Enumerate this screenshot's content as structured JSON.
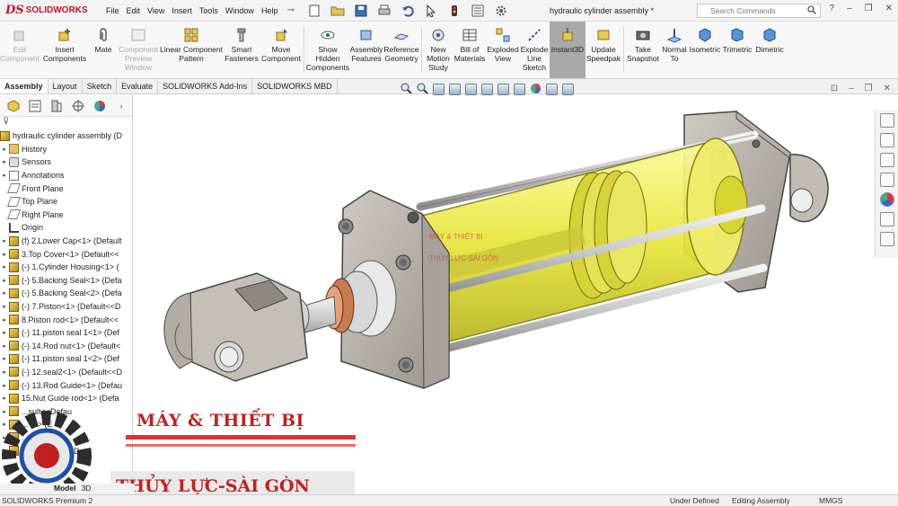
{
  "app": {
    "logo_ds": "DS",
    "logo_text": "SOLIDWORKS",
    "document_title": "hydraulic cylinder assembly *"
  },
  "menu": [
    "File",
    "Edit",
    "View",
    "Insert",
    "Tools",
    "Window",
    "Help"
  ],
  "search": {
    "placeholder": "Search Commands"
  },
  "command_manager": [
    {
      "label": "Edit Component",
      "disabled": true
    },
    {
      "label": "Insert Components",
      "disabled": false
    },
    {
      "label": "Mate",
      "disabled": false
    },
    {
      "label": "Component Preview Window",
      "disabled": true
    },
    {
      "label": "Linear Component Pattern",
      "disabled": false
    },
    {
      "label": "Smart Fasteners",
      "disabled": false
    },
    {
      "label": "Move Component",
      "disabled": false
    },
    {
      "label": "Show Hidden Components",
      "disabled": false
    },
    {
      "label": "Assembly Features",
      "disabled": false
    },
    {
      "label": "Reference Geometry",
      "disabled": false
    },
    {
      "label": "New Motion Study",
      "disabled": false
    },
    {
      "label": "Bill of Materials",
      "disabled": false
    },
    {
      "label": "Exploded View",
      "disabled": false
    },
    {
      "label": "Explode Line Sketch",
      "disabled": false
    },
    {
      "label": "Instant3D",
      "disabled": false,
      "active": true
    },
    {
      "label": "Update Speedpak",
      "disabled": false
    },
    {
      "label": "Take Snapshot",
      "disabled": false
    },
    {
      "label": "Normal To",
      "disabled": false
    },
    {
      "label": "Isometric",
      "disabled": false
    },
    {
      "label": "Trimetric",
      "disabled": false
    },
    {
      "label": "Dimetric",
      "disabled": false
    }
  ],
  "tabs": [
    "Assembly",
    "Layout",
    "Sketch",
    "Evaluate",
    "SOLIDWORKS Add-Ins",
    "SOLIDWORKS MBD"
  ],
  "tree": {
    "root": "hydraulic cylinder assembly  (D",
    "items": [
      {
        "label": "History",
        "icon": "folder"
      },
      {
        "label": "Sensors",
        "icon": "sensor"
      },
      {
        "label": "Annotations",
        "icon": "annot"
      },
      {
        "label": "Front Plane",
        "icon": "plane"
      },
      {
        "label": "Top Plane",
        "icon": "plane"
      },
      {
        "label": "Right Plane",
        "icon": "plane"
      },
      {
        "label": "Origin",
        "icon": "origin"
      },
      {
        "label": "(f) 2.Lower Cap<1> (Default",
        "icon": "cube"
      },
      {
        "label": "3.Top Cover<1> (Default<<",
        "icon": "cube"
      },
      {
        "label": "(-) 1.Cylinder Housing<1> (",
        "icon": "cube"
      },
      {
        "label": "(-) 5.Backing Seal<1> (Defa",
        "icon": "cube"
      },
      {
        "label": "(-) 5.Backing Seal<2> (Defa",
        "icon": "cube"
      },
      {
        "label": "(-) 7.Piston<1> (Default<<D",
        "icon": "cube"
      },
      {
        "label": "8.Piston rod<1> (Default<<",
        "icon": "cube"
      },
      {
        "label": "(-) 11.piston seal 1<1> (Def",
        "icon": "cube"
      },
      {
        "label": "(-) 14.Rod nut<1> (Default<",
        "icon": "cube"
      },
      {
        "label": "(-) 11.piston seal 1<2> (Def",
        "icon": "cube"
      },
      {
        "label": "(-) 12.seal2<1> (Default<<D",
        "icon": "cube"
      },
      {
        "label": "(-) 13.Rod Guide<1> (Defau",
        "icon": "cube"
      },
      {
        "label": "15.Nut Guide rod<1> (Defa",
        "icon": "cube"
      },
      {
        "label": "...sult<<Defau",
        "icon": "cube"
      },
      {
        "label": "...<1> (E",
        "icon": "cube"
      },
      {
        "label": "...<2> (De",
        "icon": "cube"
      },
      {
        "label": "...bolt nut<1> (D",
        "icon": "cube"
      }
    ]
  },
  "bottom_tabs": [
    "Model",
    "3D"
  ],
  "status": {
    "left": "SOLIDWORKS Premium 2",
    "defined": "Under Defined",
    "mode": "Editing Assembly",
    "units": "MMGS"
  },
  "watermark": {
    "line1": "MÁY & THIẾT BỊ",
    "line2": "THỦY LỰC-SÀI GÒN",
    "center1": "MÁY & THIẾT BỊ",
    "center2": "THỦY LỰC-SÀI GÒN"
  },
  "colors": {
    "brand": "#c8102e",
    "cylinder_yellow": "#e8e83a",
    "steel": "#b8b8b8",
    "watermark": "#c02020"
  }
}
